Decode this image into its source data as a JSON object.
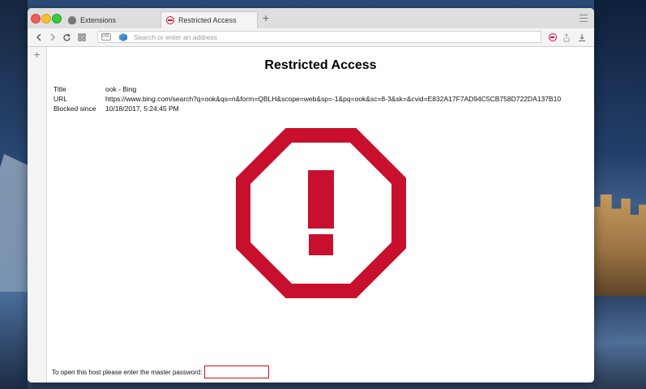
{
  "browser": {
    "tabs": [
      {
        "label": "Extensions",
        "icon": "extensions-icon"
      },
      {
        "label": "Restricted Access",
        "icon": "blocked-site-icon",
        "active": true
      }
    ],
    "new_tab_symbol": "+",
    "address_bar": {
      "placeholder": "Search or enter an address",
      "value": ""
    }
  },
  "page": {
    "title": "Restricted Access",
    "info": [
      {
        "key": "Title",
        "value": "ook - Bing"
      },
      {
        "key": "URL",
        "value": "https://www.bing.com/search?q=ook&qs=n&form=QBLH&scope=web&sp=-1&pq=ook&sc=8-3&sk=&cvid=E832A17F7AD94C5CB758D722DA137B10"
      },
      {
        "key": "Blocked since",
        "value": "10/18/2017, 5:24:45 PM"
      }
    ],
    "warning_icon": "stop-sign-exclamation-icon",
    "password_prompt": "To open this host please enter the master password:",
    "password_value": ""
  },
  "colors": {
    "warning_red": "#c8102e",
    "password_border": "#d20e1e"
  }
}
